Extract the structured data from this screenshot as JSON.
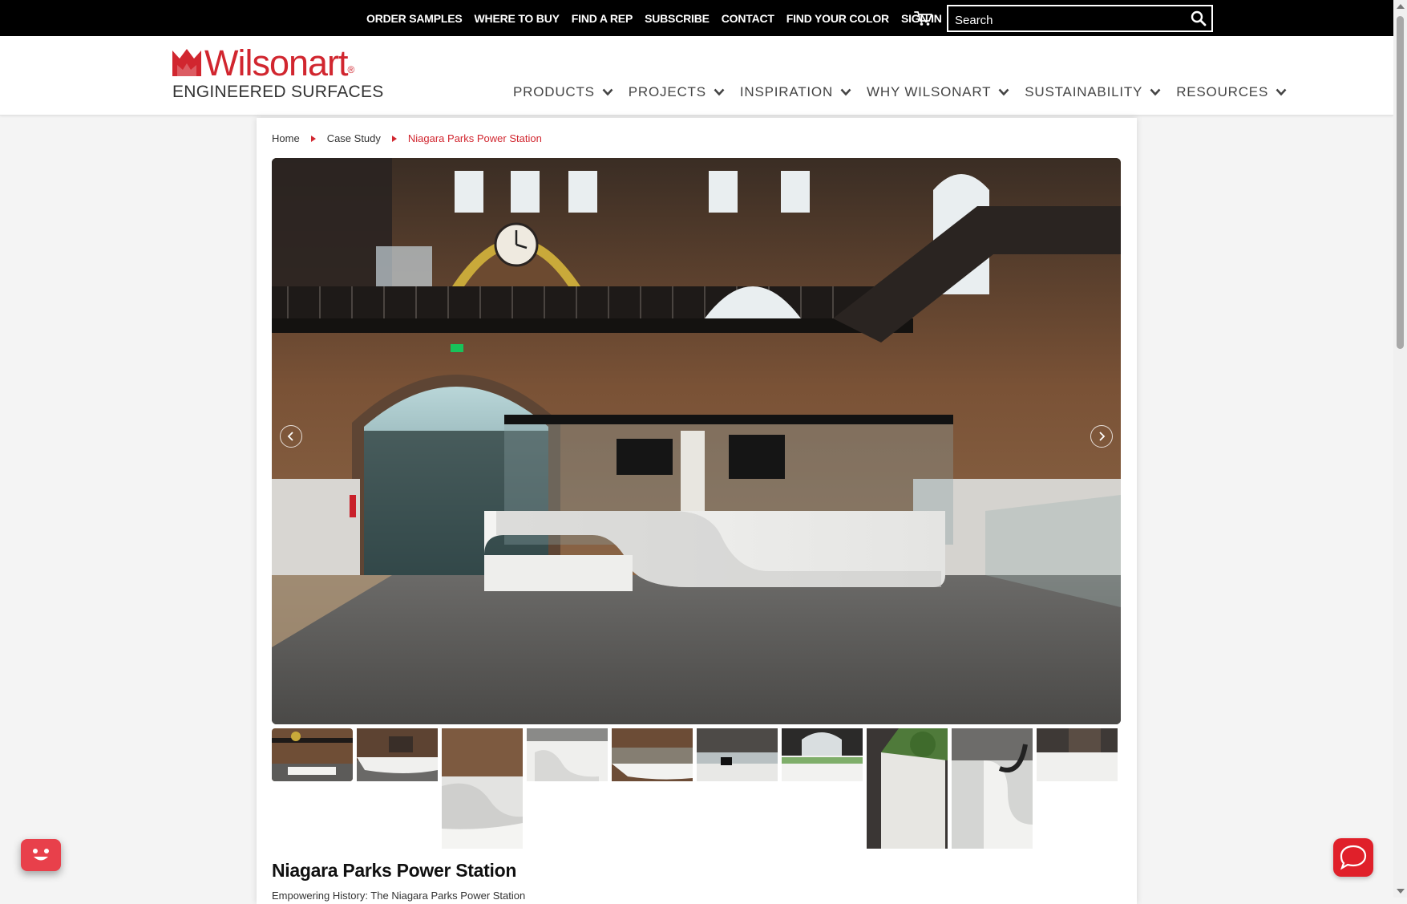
{
  "utility_nav": {
    "links": [
      "ORDER SAMPLES",
      "WHERE TO BUY",
      "FIND A REP",
      "SUBSCRIBE",
      "CONTACT",
      "FIND YOUR COLOR",
      "SIGN IN"
    ],
    "cart_icon": "cart-icon",
    "search_placeholder": "Search",
    "search_icon": "search-icon"
  },
  "logo": {
    "brand": "Wilsonart",
    "registered": "®",
    "tagline": "ENGINEERED SURFACES"
  },
  "main_nav": [
    {
      "label": "PRODUCTS"
    },
    {
      "label": "PROJECTS"
    },
    {
      "label": "INSPIRATION"
    },
    {
      "label": "WHY WILSONART"
    },
    {
      "label": "SUSTAINABILITY"
    },
    {
      "label": "RESOURCES"
    }
  ],
  "breadcrumb": {
    "items": [
      "Home",
      "Case Study"
    ],
    "current": "Niagara Parks Power Station"
  },
  "gallery": {
    "thumbnail_count": 10
  },
  "article": {
    "title": "Niagara Parks Power Station",
    "subtitle": "Empowering History: The Niagara Parks Power Station"
  },
  "colors": {
    "brand_red": "#d1262f",
    "topbar": "#000000",
    "chat_red": "#e0202a"
  }
}
